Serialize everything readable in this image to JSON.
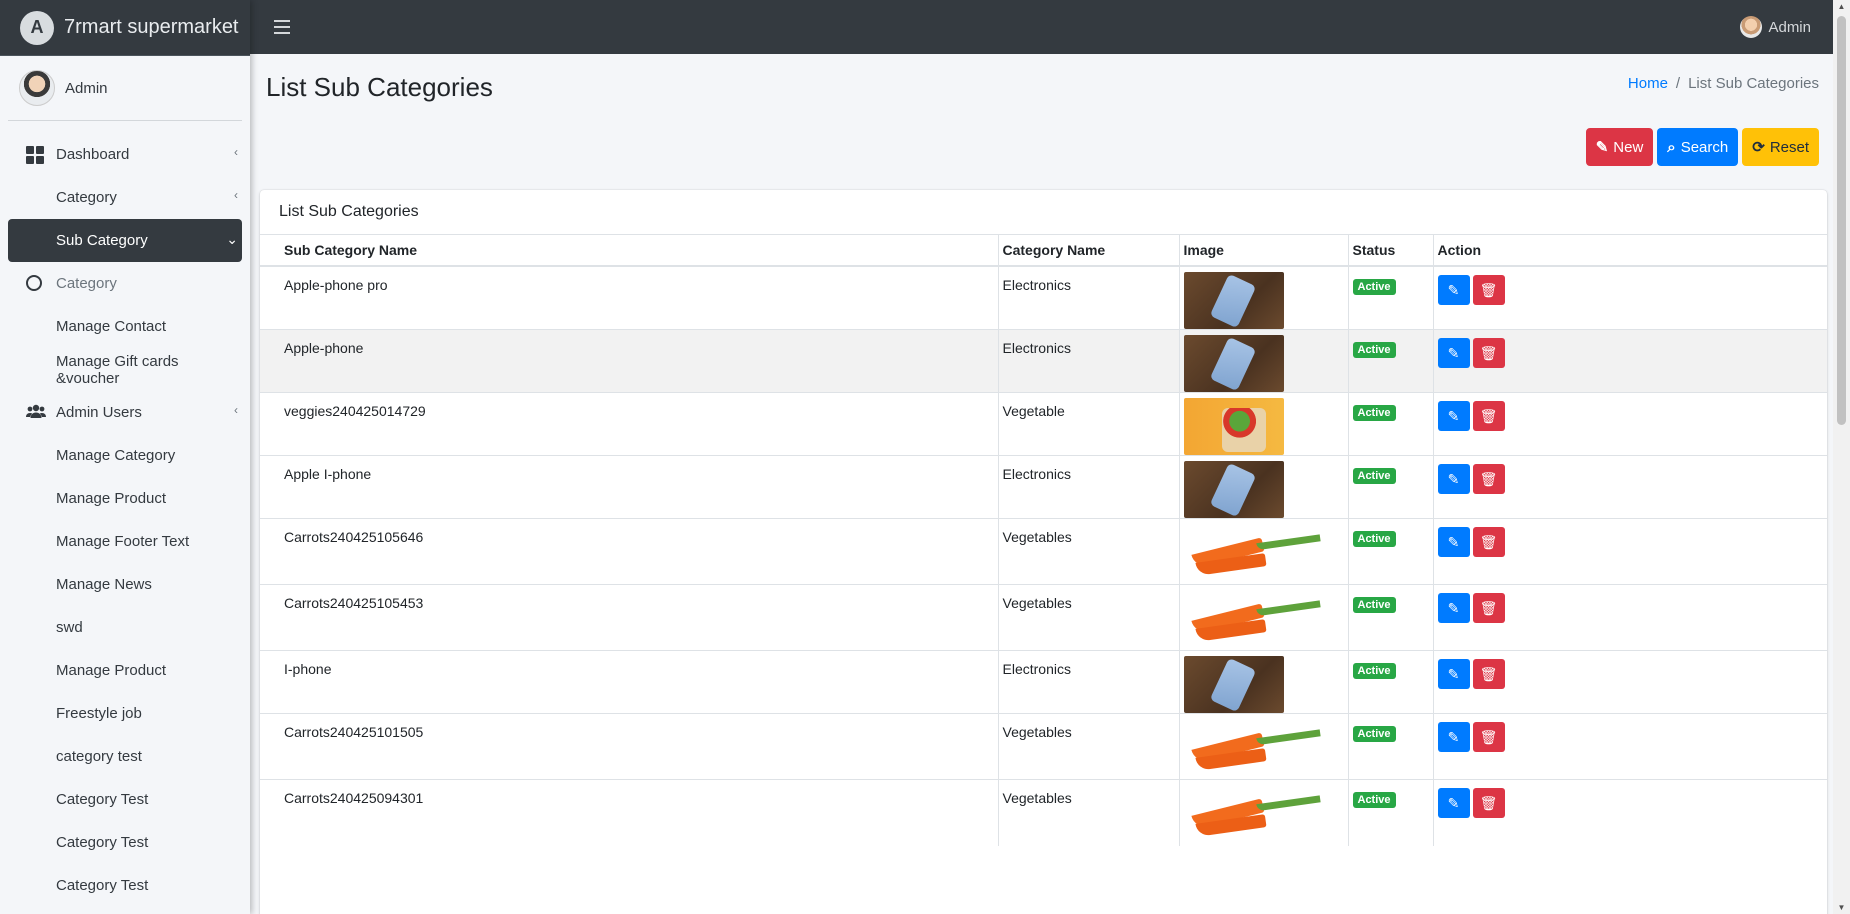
{
  "brand": {
    "name": "7rmart supermarket",
    "logo_letter": "A"
  },
  "sidebar": {
    "user": "Admin",
    "items": [
      {
        "label": "Dashboard",
        "icon": "dashboard-icon",
        "chevron": "‹"
      },
      {
        "label": "Category",
        "icon": "",
        "chevron": "‹"
      },
      {
        "label": "Sub Category",
        "icon": "",
        "chevron": "⌄",
        "active": true
      },
      {
        "label": "Category",
        "icon": "circle-icon",
        "muted": true
      },
      {
        "label": "Manage Contact"
      },
      {
        "label": "Manage Gift cards &voucher"
      },
      {
        "label": "Admin Users",
        "icon": "users-icon",
        "chevron": "‹"
      },
      {
        "label": "Manage Category"
      },
      {
        "label": "Manage Product"
      },
      {
        "label": "Manage Footer Text"
      },
      {
        "label": "Manage News"
      },
      {
        "label": "swd"
      },
      {
        "label": "Manage Product"
      },
      {
        "label": "Freestyle job"
      },
      {
        "label": "category test"
      },
      {
        "label": "Category Test"
      },
      {
        "label": "Category Test"
      },
      {
        "label": "Category Test"
      }
    ]
  },
  "topbar": {
    "user": "Admin"
  },
  "page": {
    "title": "List Sub Categories",
    "breadcrumb": {
      "home": "Home",
      "separator": "/",
      "current": "List Sub Categories"
    },
    "buttons": {
      "new": "New",
      "search": "Search",
      "reset": "Reset"
    },
    "card_title": "List Sub Categories"
  },
  "table": {
    "headers": [
      "Sub Category Name",
      "Category Name",
      "Image",
      "Status",
      "Action"
    ],
    "rows": [
      {
        "name": "Apple-phone pro",
        "category": "Electronics",
        "image": "phone",
        "status": "Active"
      },
      {
        "name": "Apple-phone",
        "category": "Electronics",
        "image": "phone",
        "status": "Active"
      },
      {
        "name": "veggies240425014729",
        "category": "Vegetable",
        "image": "veg",
        "status": "Active"
      },
      {
        "name": "Apple I-phone",
        "category": "Electronics",
        "image": "phone",
        "status": "Active"
      },
      {
        "name": "Carrots240425105646",
        "category": "Vegetables",
        "image": "carrot",
        "status": "Active"
      },
      {
        "name": "Carrots240425105453",
        "category": "Vegetables",
        "image": "carrot",
        "status": "Active"
      },
      {
        "name": "I-phone",
        "category": "Electronics",
        "image": "phone",
        "status": "Active"
      },
      {
        "name": "Carrots240425101505",
        "category": "Vegetables",
        "image": "carrot",
        "status": "Active"
      },
      {
        "name": "Carrots240425094301",
        "category": "Vegetables",
        "image": "carrot",
        "status": "Active"
      }
    ]
  },
  "colors": {
    "sidebar_dark": "#343a40",
    "primary": "#007bff",
    "danger": "#dc3545",
    "warning": "#ffc107",
    "success": "#28a745"
  }
}
